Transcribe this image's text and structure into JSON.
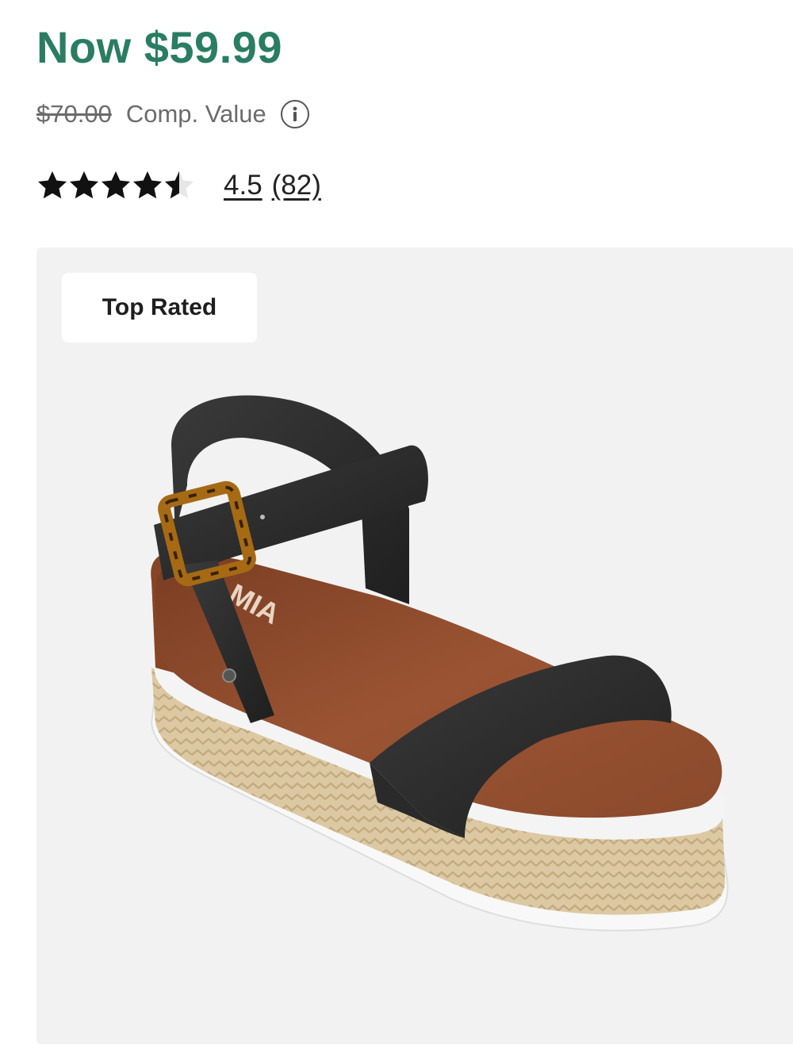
{
  "price": {
    "now": "Now $59.99",
    "original": "$70.00",
    "comp_label": "Comp. Value"
  },
  "rating": {
    "value": "4.5",
    "count": "(82)",
    "stars_filled": 4.5,
    "stars_total": 5
  },
  "product_image": {
    "badge": "Top Rated",
    "brand_mark": "MIA"
  },
  "colors": {
    "price_green": "#2a7d62",
    "panel_bg": "#f2f2f2",
    "strap_black": "#2b2b2b",
    "footbed_brown": "#8a4a2c",
    "jute": "#dcc9a3"
  },
  "icons": {
    "info": "info-icon",
    "star": "star-icon"
  }
}
